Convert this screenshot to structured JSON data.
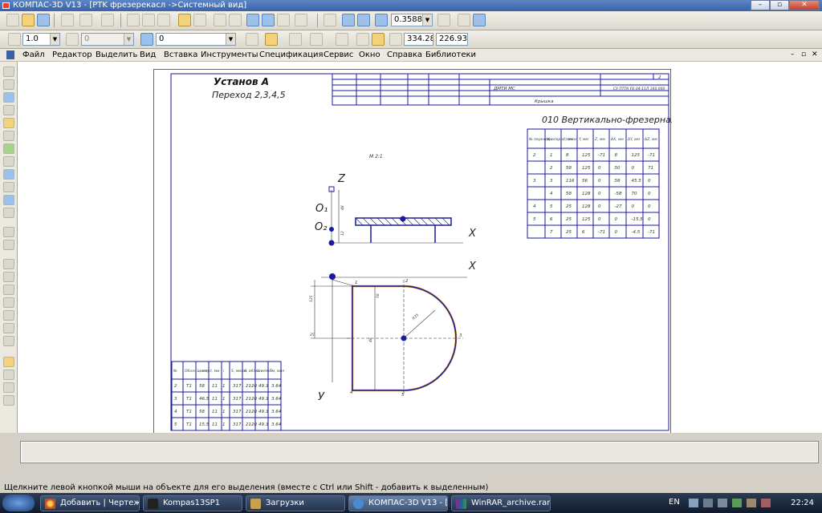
{
  "window": {
    "title": "КОМПАС-3D V13 - [PTK фрезерекасл ->Системный вид]",
    "buttons": [
      "–",
      "▫",
      "✕"
    ]
  },
  "toolbar2": {
    "line_scale": "1.0",
    "layer": "0",
    "style": "0",
    "x_coord": "334.288",
    "y_coord": "226.936",
    "zoom": "0.3588"
  },
  "menu": {
    "items": [
      "Файл",
      "Редактор",
      "Выделить",
      "Вид",
      "Вставка",
      "Инструменты",
      "Спецификация",
      "Сервис",
      "Окно",
      "Справка",
      "Библиотеки"
    ]
  },
  "drawing": {
    "title": "Установ А",
    "subtitle": "Переход 2,3,4,5",
    "operation": "010 Вертикально-фрезерная",
    "scale_note": "М 2:1",
    "stamp_org": "ДМТИ МС",
    "stamp_code": "СУ ПТТК Р2.04-11Л 160.000",
    "stamp_part": "Крышка",
    "stamp_sheet": "2",
    "axis_z": "Z",
    "axis_x": "X",
    "axis_y": "У",
    "label_o1": "O₁",
    "label_o2": "O₂",
    "dims": [
      "48",
      "12",
      "125",
      "25",
      "58",
      "R35",
      "48",
      "3",
      "2",
      "1",
      "4",
      "5"
    ],
    "coord_table": {
      "headers": [
        "№ перехода",
        "№ опорн. точки",
        "X, мм",
        "Y, мм",
        "Z, мм",
        "ΔX, мм",
        "ΔY, мм",
        "ΔZ, мм"
      ],
      "rows": [
        [
          "2",
          "1",
          "8",
          "125",
          "-71",
          "8",
          "125",
          "-71"
        ],
        [
          "",
          "2",
          "58",
          "125",
          "0",
          "50",
          "0",
          "71"
        ],
        [
          "3",
          "3",
          "116",
          "56",
          "0",
          "58",
          "45.5",
          "0"
        ],
        [
          "",
          "4",
          "58",
          "128",
          "0",
          "-58",
          "70",
          "0"
        ],
        [
          "4",
          "5",
          "25",
          "128",
          "0",
          "-27",
          "0",
          "0"
        ],
        [
          "5",
          "6",
          "25",
          "125",
          "0",
          "0",
          "-15.5",
          "0"
        ],
        [
          "",
          "7",
          "25",
          "6",
          "-71",
          "0",
          "-4.5",
          "-71"
        ]
      ]
    },
    "mode_table": {
      "headers": [
        "№",
        "Обозн. инстр.",
        "L, мм",
        "t, мм",
        "i",
        "S, мм/об",
        "n, об/мин",
        "V, м/мин",
        "Tм, мин"
      ],
      "rows": [
        [
          "2",
          "T1",
          "58",
          "11",
          "1",
          "317",
          "2120",
          "49.3",
          "3.64"
        ],
        [
          "3",
          "T1",
          "46.5",
          "11",
          "1",
          "317",
          "2120",
          "49.3",
          "3.64"
        ],
        [
          "4",
          "T1",
          "58",
          "11",
          "1",
          "317",
          "2120",
          "49.3",
          "3.64"
        ],
        [
          "5",
          "T1",
          "15.5",
          "11",
          "1",
          "317",
          "2120",
          "49.3",
          "3.64"
        ]
      ]
    }
  },
  "status": {
    "hint": "Щелкните левой кнопкой мыши на объекте для его выделения (вместе с Ctrl или Shift - добавить к выделенным)"
  },
  "taskbar": {
    "tasks": [
      "Добавить | Чертежи...",
      "Kompas13SP1",
      "Загрузки",
      "КОМПАС-3D V13 - [...",
      "WinRAR_archive.rar -..."
    ],
    "lang": "EN",
    "clock": "22:24"
  }
}
